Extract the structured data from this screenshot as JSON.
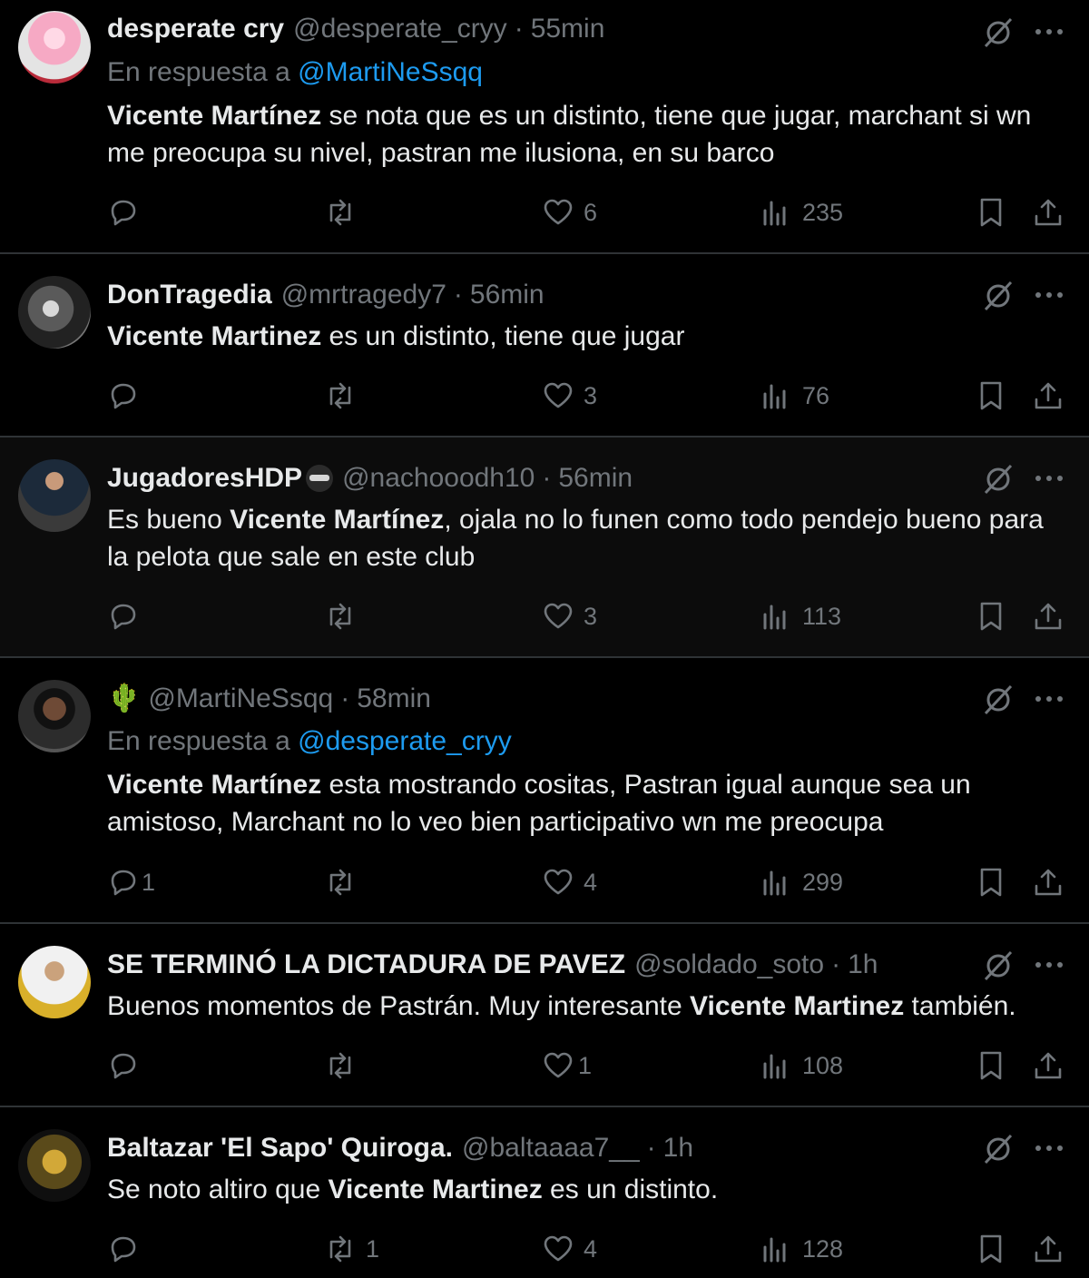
{
  "reply_prefix": "En respuesta a",
  "dot": "·",
  "tweets": [
    {
      "name": "desperate cry",
      "handle": "@desperate_cryy",
      "time": "55min",
      "reply_to": "@MartiNeSsqq",
      "text_before": "",
      "text_bold": "Vicente Martínez",
      "text_after": " se nota que es un distinto, tiene que jugar, marchant si wn me preocupa su nivel, pastran me ilusiona, en su barco",
      "replies": "",
      "retweets": "",
      "likes": "6",
      "views": "235"
    },
    {
      "name": "DonTragedia",
      "handle": "@mrtragedy7",
      "time": "56min",
      "text_before": "",
      "text_bold": "Vicente Martinez",
      "text_after": " es un distinto, tiene que jugar",
      "replies": "",
      "retweets": "",
      "likes": "3",
      "views": "76"
    },
    {
      "name": "JugadoresHDP",
      "handle": "@nachooodh10",
      "time": "56min",
      "text_before": "Es bueno ",
      "text_bold": "Vicente Martínez",
      "text_after": ", ojala no lo funen como todo pendejo bueno para la pelota que sale en este club",
      "replies": "",
      "retweets": "",
      "likes": "3",
      "views": "113"
    },
    {
      "name": "",
      "name_emoji": "🌵",
      "handle": "@MartiNeSsqq",
      "time": "58min",
      "reply_to": "@desperate_cryy",
      "text_before": "",
      "text_bold": "Vicente Martínez",
      "text_after": " esta mostrando cositas, Pastran igual aunque sea un amistoso, Marchant no lo veo bien participativo wn me preocupa",
      "replies": "1",
      "retweets": "",
      "likes": "4",
      "views": "299"
    },
    {
      "name": "SE TERMINÓ LA DICTADURA DE PAVEZ",
      "handle": "@soldado_soto",
      "time": "1h",
      "text_before": "Buenos momentos de Pastrán. Muy interesante ",
      "text_bold": "Vicente Martinez",
      "text_after": " también.",
      "replies": "",
      "retweets": "",
      "likes": "1",
      "views": "108"
    },
    {
      "name": "Baltazar 'El Sapo' Quiroga.",
      "handle": "@baltaaaa7__",
      "time": "1h",
      "text_before": "Se noto altiro que ",
      "text_bold": "Vicente Martinez",
      "text_after": " es un distinto.",
      "replies": "",
      "retweets": "1",
      "likes": "4",
      "views": "128"
    }
  ]
}
